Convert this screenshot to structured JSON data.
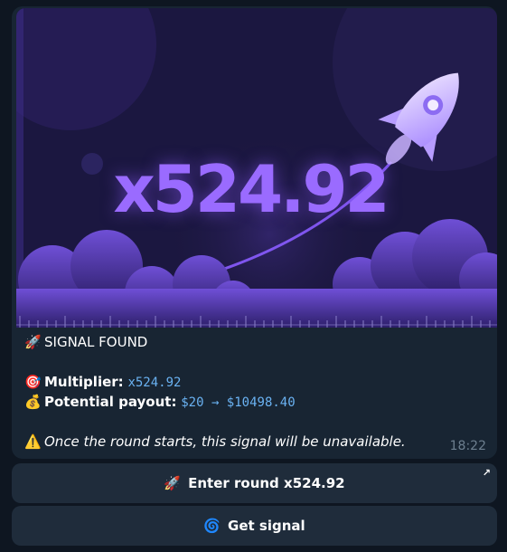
{
  "message": {
    "hero_multiplier": "x524.92",
    "title_emoji": "🚀",
    "title": "SIGNAL FOUND",
    "multiplier_emoji": "🎯",
    "multiplier_label": "Multiplier:",
    "multiplier_value": "x524.92",
    "payout_emoji": "💰",
    "payout_label": "Potential payout:",
    "payout_value": "$20 → $10498.40",
    "warning_emoji": "⚠️",
    "warning_text": "Once the round starts, this signal will be unavailable.",
    "time": "18:22"
  },
  "keyboard": {
    "enter_round": {
      "emoji": "🚀",
      "label": "Enter round x524.92",
      "corner_icon": "↗"
    },
    "get_signal": {
      "emoji": "🌀",
      "label": "Get signal"
    }
  },
  "colors": {
    "background": "#0e1621",
    "bubble": "#182533",
    "button": "#1f2c3b",
    "accent_mono": "#6ab2f2",
    "multiplier_art": "#9a6bff"
  }
}
